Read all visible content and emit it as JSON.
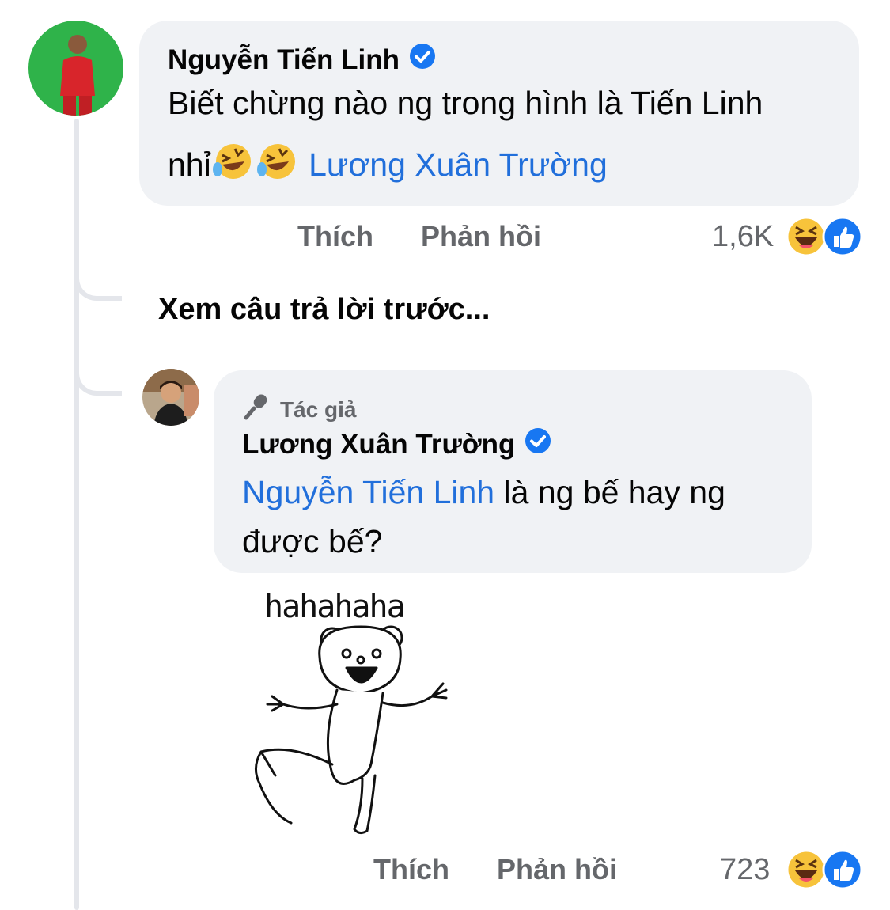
{
  "comment1": {
    "author": "Nguyễn Tiến Linh",
    "text_line1": "Biết chừng nào ng trong hình là Tiến Linh",
    "text_line2_prefix": "nhỉ",
    "mention": "Lương Xuân Trường",
    "like_label": "Thích",
    "reply_label": "Phản hồi",
    "reaction_count": "1,6K",
    "reaction_icons": [
      "haha-icon",
      "like-icon"
    ]
  },
  "thread": {
    "see_previous": "Xem câu trả lời trước..."
  },
  "comment2": {
    "author_badge": "Tác giả",
    "author": "Lương Xuân Trường",
    "mention": "Nguyễn Tiến Linh",
    "text_after_mention": " là ng bế hay ng",
    "text_line2": "được bế?",
    "sticker_text": "hahahaha",
    "like_label": "Thích",
    "reply_label": "Phản hồi",
    "reaction_count": "723",
    "reaction_icons": [
      "haha-icon",
      "like-icon"
    ]
  },
  "colors": {
    "bubble_bg": "#f0f2f5",
    "mention": "#216fdb",
    "verified": "#1877f2",
    "secondary_text": "#65676b"
  }
}
